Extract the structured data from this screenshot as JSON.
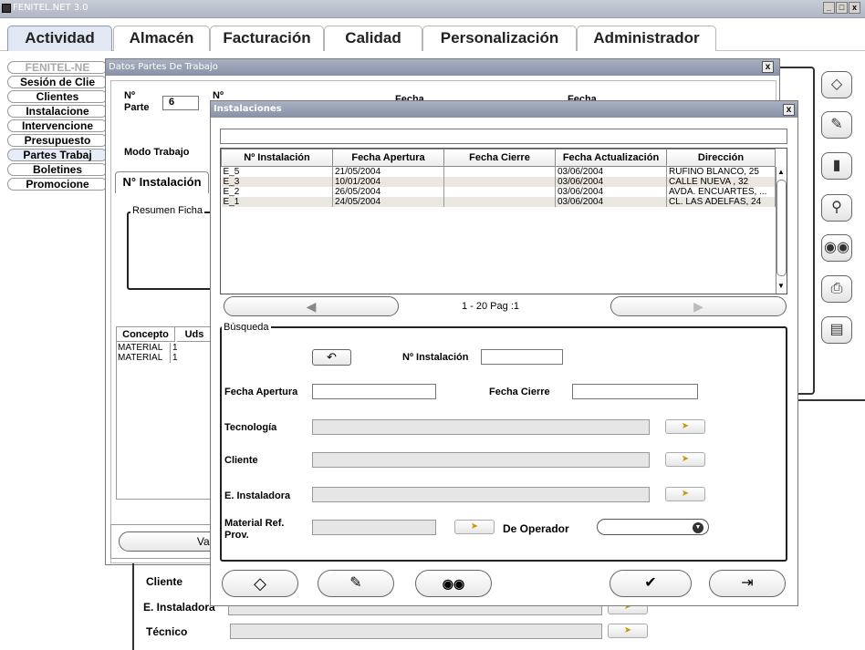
{
  "app": {
    "title": "FENITEL.NET 3.0",
    "min": "_",
    "max": "□",
    "close": "x"
  },
  "tabs": [
    "Actividad",
    "Almacén",
    "Facturación",
    "Calidad",
    "Personalización",
    "Administrador"
  ],
  "sidebar": {
    "header": "FENITEL-NE",
    "items": [
      "Sesión de Clie",
      "Clientes",
      "Instalacione",
      "Intervencione",
      "Presupuesto",
      "Partes Trabaj",
      "Boletines",
      "Promocione"
    ]
  },
  "partes": {
    "title": "Datos Partes De Trabajo",
    "close": "x",
    "nparte_label1": "Nº",
    "nparte_label2": "Parte",
    "nparte_value": "6",
    "n_label": "Nº",
    "fecha1": "Fecha",
    "fecha2": "Fecha",
    "modo_trabajo": "Modo Trabajo",
    "ninstalacion_tab": "N° Instalación",
    "resumen_legend": "Resumen Ficha",
    "concepto_header": "Concepto",
    "uds_header": "Uds",
    "rows": [
      {
        "concepto": "MATERIAL",
        "uds": "1"
      },
      {
        "concepto": "MATERIAL",
        "uds": "1"
      }
    ],
    "vaciar": "Vaciar",
    "cliente": "Cliente",
    "e_instaladora": "E. Instaladora",
    "tecnico": "Técnico"
  },
  "dialog": {
    "title": "Instalaciones",
    "close": "x",
    "columns": [
      "Nº Instalación",
      "Fecha Apertura",
      "Fecha Cierre",
      "Fecha Actualización",
      "Dirección"
    ],
    "rows": [
      [
        "E_5",
        "21/05/2004",
        "",
        "03/06/2004",
        "RUFINO BLANCO, 25"
      ],
      [
        "E_3",
        "10/01/2004",
        "",
        "03/06/2004",
        "CALLE NUEVA , 32"
      ],
      [
        "E_2",
        "26/05/2004",
        "",
        "03/06/2004",
        "AVDA. ENCUARTES, ..."
      ],
      [
        "E_1",
        "24/05/2004",
        "",
        "03/06/2004",
        "CL. LAS ADELFAS, 24"
      ]
    ],
    "pagination": "1 - 20 Pag :1",
    "search": {
      "legend": "Búsqueda",
      "ninstalacion": "Nº Instalación",
      "fecha_apertura": "Fecha Apertura",
      "fecha_cierre": "Fecha Cierre",
      "tecnologia": "Tecnología",
      "cliente": "Cliente",
      "e_instaladora": "E. Instaladora",
      "material_ref": "Material Ref. Prov.",
      "de_operador": "De Operador"
    }
  },
  "colors": {
    "accent": "#8791a6",
    "tab_active": "#e2e8f3",
    "row_alt": "#ebe6e0"
  }
}
